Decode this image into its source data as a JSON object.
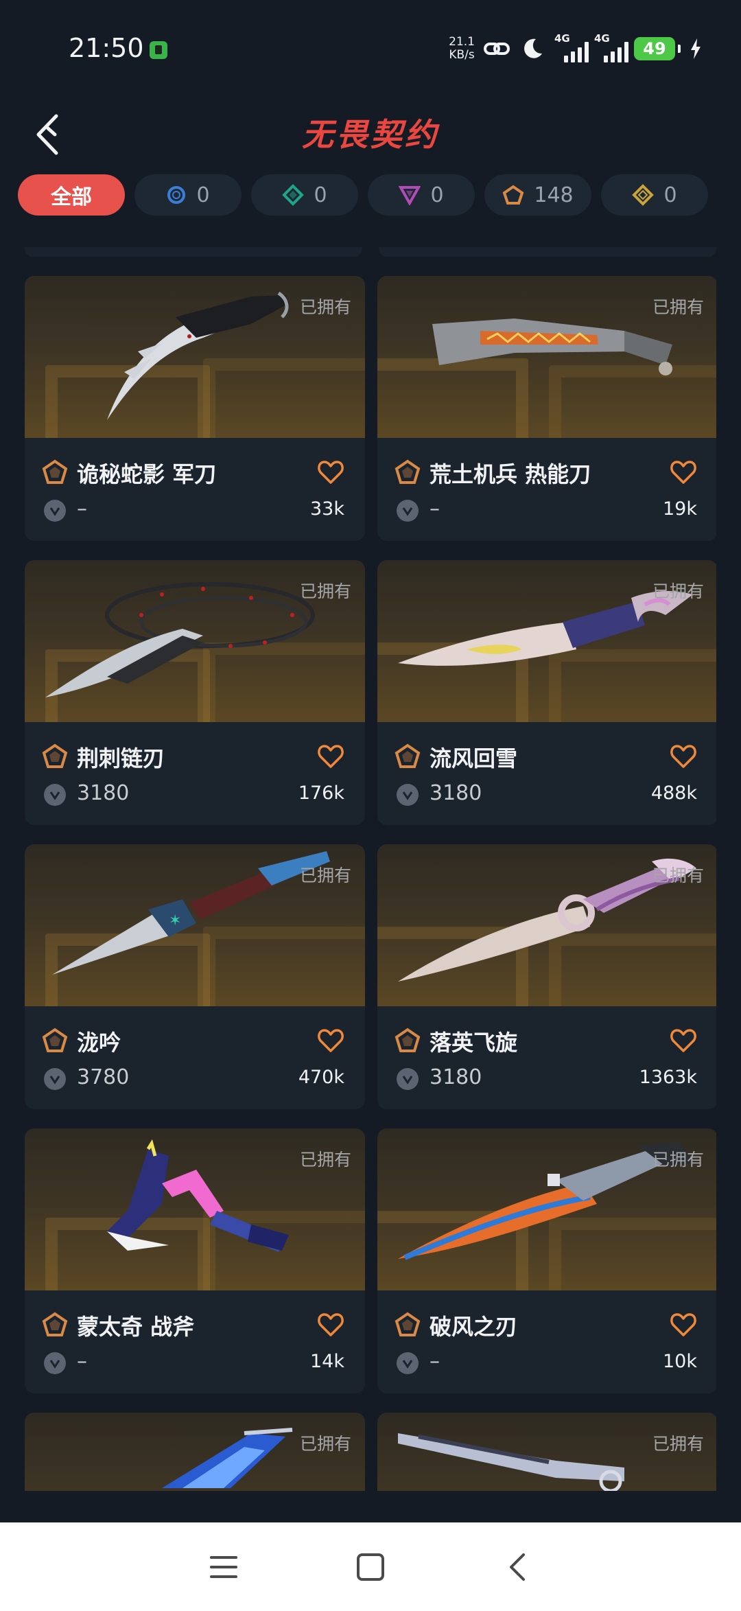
{
  "status_bar": {
    "time": "21:50",
    "net_speed_value": "21.1",
    "net_speed_unit": "KB/s",
    "signal_1_label": "4G",
    "signal_2_label": "4G",
    "battery": "49"
  },
  "header": {
    "title": "无畏契约"
  },
  "filters": [
    {
      "label": "全部",
      "icon": "none",
      "color": "#ffffff"
    },
    {
      "label": "0",
      "icon": "ring-icon",
      "color": "#3a7ed8"
    },
    {
      "label": "0",
      "icon": "diamond-icon",
      "color": "#1fa58a"
    },
    {
      "label": "0",
      "icon": "triangle-icon",
      "color": "#b04bb8"
    },
    {
      "label": "148",
      "icon": "pentagon-icon",
      "color": "#d98a46"
    },
    {
      "label": "0",
      "icon": "diamond-icon",
      "color": "#c9a43a"
    }
  ],
  "items": [
    {
      "name": "诡秘蛇影 军刀",
      "price": "–",
      "likes": "33k",
      "owned": "已拥有"
    },
    {
      "name": "荒土机兵 热能刀",
      "price": "–",
      "likes": "19k",
      "owned": "已拥有"
    },
    {
      "name": "荆刺链刃",
      "price": "3180",
      "likes": "176k",
      "owned": "已拥有"
    },
    {
      "name": "流风回雪",
      "price": "3180",
      "likes": "488k",
      "owned": "已拥有"
    },
    {
      "name": "泷吟",
      "price": "3780",
      "likes": "470k",
      "owned": "已拥有"
    },
    {
      "name": "落英飞旋",
      "price": "3180",
      "likes": "1363k",
      "owned": "已拥有"
    },
    {
      "name": "蒙太奇 战斧",
      "price": "–",
      "likes": "14k",
      "owned": "已拥有"
    },
    {
      "name": "破风之刃",
      "price": "–",
      "likes": "10k",
      "owned": "已拥有"
    },
    {
      "name": "",
      "price": "",
      "likes": "",
      "owned": "已拥有"
    },
    {
      "name": "",
      "price": "",
      "likes": "",
      "owned": "已拥有"
    }
  ],
  "colors": {
    "background": "#141b24",
    "card": "#1b232d",
    "accent_red": "#e8524d",
    "tier_orange": "#d98a46"
  },
  "nav": {
    "menu_icon": "menu-icon",
    "home_icon": "home-icon",
    "back_icon": "back-icon"
  }
}
